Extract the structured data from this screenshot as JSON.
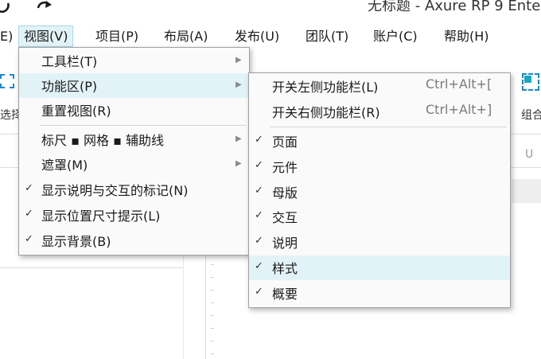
{
  "window": {
    "title": "无标题 - Axure RP 9 Ente"
  },
  "menubar": {
    "partial_item": "E)",
    "items": [
      {
        "label": "视图(V)"
      },
      {
        "label": "项目(P)"
      },
      {
        "label": "布局(A)"
      },
      {
        "label": "发布(U)"
      },
      {
        "label": "团队(T)"
      },
      {
        "label": "账户(C)"
      },
      {
        "label": "帮助(H)"
      }
    ]
  },
  "toolbar": {
    "select_label": "选择",
    "group_label": "组合"
  },
  "view_menu": {
    "items": [
      {
        "label": "工具栏(T)",
        "checked": false,
        "submenu": true
      },
      {
        "label": "功能区(P)",
        "checked": false,
        "submenu": true,
        "highlighted": true
      },
      {
        "label": "重置视图(R)",
        "checked": false,
        "submenu": false
      },
      {
        "label": "标尺 ▪ 网格 ▪ 辅助线",
        "checked": false,
        "submenu": true
      },
      {
        "label": "遮罩(M)",
        "checked": false,
        "submenu": true
      },
      {
        "label": "显示说明与交互的标记(N)",
        "checked": true,
        "submenu": false
      },
      {
        "label": "显示位置尺寸提示(L)",
        "checked": true,
        "submenu": false
      },
      {
        "label": "显示背景(B)",
        "checked": true,
        "submenu": false
      }
    ]
  },
  "panes_menu": {
    "top_items": [
      {
        "label": "开关左侧功能栏(L)",
        "shortcut": "Ctrl+Alt+["
      },
      {
        "label": "开关右侧功能栏(R)",
        "shortcut": "Ctrl+Alt+]"
      }
    ],
    "pane_items": [
      {
        "label": "页面",
        "checked": true
      },
      {
        "label": "元件",
        "checked": true
      },
      {
        "label": "母版",
        "checked": true
      },
      {
        "label": "交互",
        "checked": true
      },
      {
        "label": "说明",
        "checked": true
      },
      {
        "label": "样式",
        "checked": true,
        "highlighted": true
      },
      {
        "label": "概要",
        "checked": true
      }
    ]
  },
  "icons": {
    "undo": "undo-icon",
    "redo": "redo-icon",
    "check": "✓",
    "submenu_arrow": "▶"
  },
  "colors": {
    "highlight": "#e2f3f8",
    "highlight_border": "#a8d8e8",
    "accent": "#1e88c8"
  }
}
